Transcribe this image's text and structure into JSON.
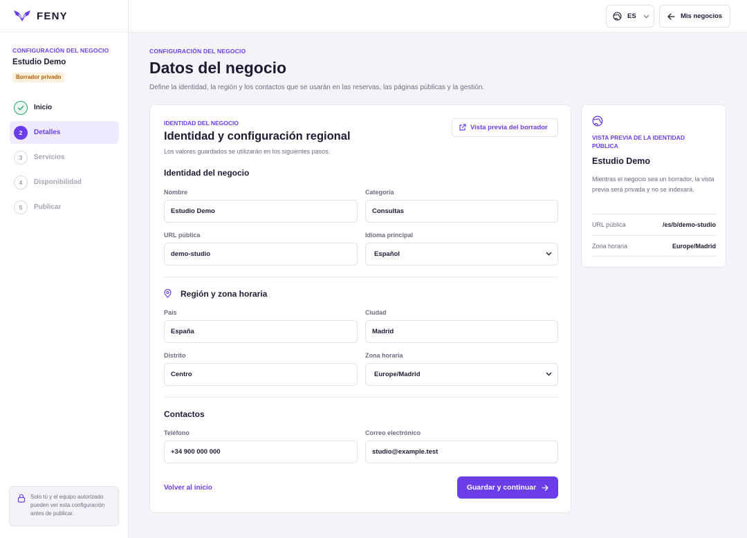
{
  "brand": {
    "name": "FENY"
  },
  "sidebar": {
    "eyebrow": "CONFIGURACIÓN DEL NEGOCIO",
    "business_name": "Estudio Demo",
    "badge": "Borrador privado",
    "steps": [
      {
        "number": "",
        "label": "Inicio",
        "state": "done"
      },
      {
        "number": "2",
        "label": "Detalles",
        "state": "active"
      },
      {
        "number": "3",
        "label": "Servicios",
        "state": "pending"
      },
      {
        "number": "4",
        "label": "Disponibilidad",
        "state": "pending"
      },
      {
        "number": "5",
        "label": "Publicar",
        "state": "pending"
      }
    ],
    "note": "Solo tú y el equipo autorizado pueden ver esta configuración antes de publicar."
  },
  "topbar": {
    "language": "ES",
    "my_businesses": "Mis negocios"
  },
  "header": {
    "eyebrow": "CONFIGURACIÓN DEL NEGOCIO",
    "title": "Datos del negocio",
    "description": "Define la identidad, la región y los contactos que se usarán en las reservas, las páginas públicas y la gestión."
  },
  "form": {
    "eyebrow": "IDENTIDAD DEL NEGOCIO",
    "title": "Identidad y configuración regional",
    "subtitle": "Los valores guardados se utilizarán en los siguientes pasos.",
    "preview_button": "Vista previa del borrador",
    "identity": {
      "heading": "Identidad del negocio",
      "name_label": "Nombre",
      "name_value": "Estudio Demo",
      "category_label": "Categoría",
      "category_value": "Consultas",
      "url_label": "URL pública",
      "url_value": "demo-studio",
      "language_label": "Idioma principal",
      "language_value": "Español"
    },
    "region": {
      "heading": "Región y zona horaria",
      "country_label": "País",
      "country_value": "España",
      "city_label": "Ciudad",
      "city_value": "Madrid",
      "district_label": "Distrito",
      "district_value": "Centro",
      "timezone_label": "Zona horaria",
      "timezone_value": "Europe/Madrid"
    },
    "contacts": {
      "heading": "Contactos",
      "phone_label": "Teléfono",
      "phone_value": "+34 900 000 000",
      "email_label": "Correo electrónico",
      "email_value": "studio@example.test"
    },
    "back_link": "Volver al inicio",
    "save_button": "Guardar y continuar"
  },
  "preview_card": {
    "eyebrow": "VISTA PREVIA DE LA IDENTIDAD PÚBLICA",
    "name": "Estudio Demo",
    "description": "Mientras el negocio sea un borrador, la vista previa será privada y no se indexará.",
    "url_label": "URL pública",
    "url_value": "/es/b/demo-studio",
    "timezone_label": "Zona horaria",
    "timezone_value": "Europe/Madrid"
  },
  "colors": {
    "accent": "#6a3de8",
    "success": "#2fa36b",
    "badge_text": "#b55a08"
  }
}
